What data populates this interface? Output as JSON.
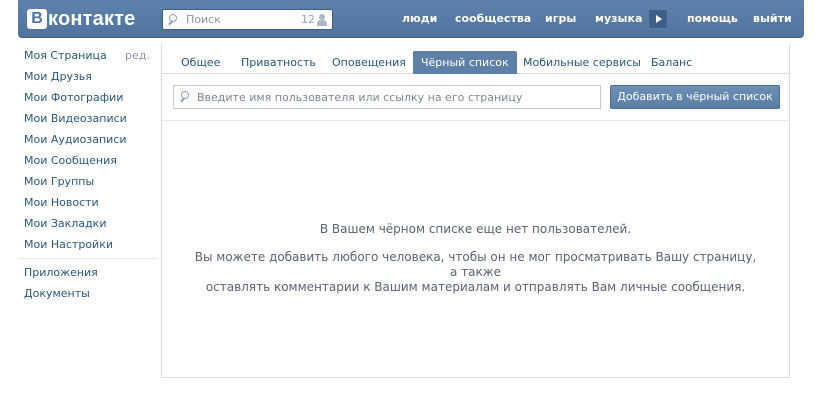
{
  "header": {
    "logo_letter": "В",
    "logo_text": "контакте",
    "search": {
      "placeholder": "Поиск",
      "count": "12"
    },
    "nav": [
      "люди",
      "сообщества",
      "игры",
      "музыка",
      "помощь",
      "выйти"
    ]
  },
  "sidebar": {
    "edit_label": "ред.",
    "items": [
      "Моя Страница",
      "Мои Друзья",
      "Мои Фотографии",
      "Мои Видеозаписи",
      "Мои Аудиозаписи",
      "Мои Сообщения",
      "Мои Группы",
      "Мои Новости",
      "Мои Закладки",
      "Мои Настройки"
    ],
    "extra_items": [
      "Приложения",
      "Документы"
    ]
  },
  "tabs": [
    "Общее",
    "Приватность",
    "Оповещения",
    "Чёрный список",
    "Мобильные сервисы",
    "Баланс"
  ],
  "active_tab": "Чёрный список",
  "blacklist": {
    "input_placeholder": "Введите имя пользователя или ссылку на его страницу",
    "add_button": "Добавить в чёрный список",
    "empty_title": "В Вашем чёрном списке еще нет пользователей.",
    "empty_desc_line1": "Вы можете добавить любого человека, чтобы он не мог просматривать Вашу страницу, а также",
    "empty_desc_line2": "оставлять комментарии к Вашим материалам и отправлять Вам личные сообщения."
  },
  "colors": {
    "header_bg": "#5a7da8",
    "link": "#2b587a",
    "active_tab": "#5e80a6",
    "button": "#6185ad"
  }
}
